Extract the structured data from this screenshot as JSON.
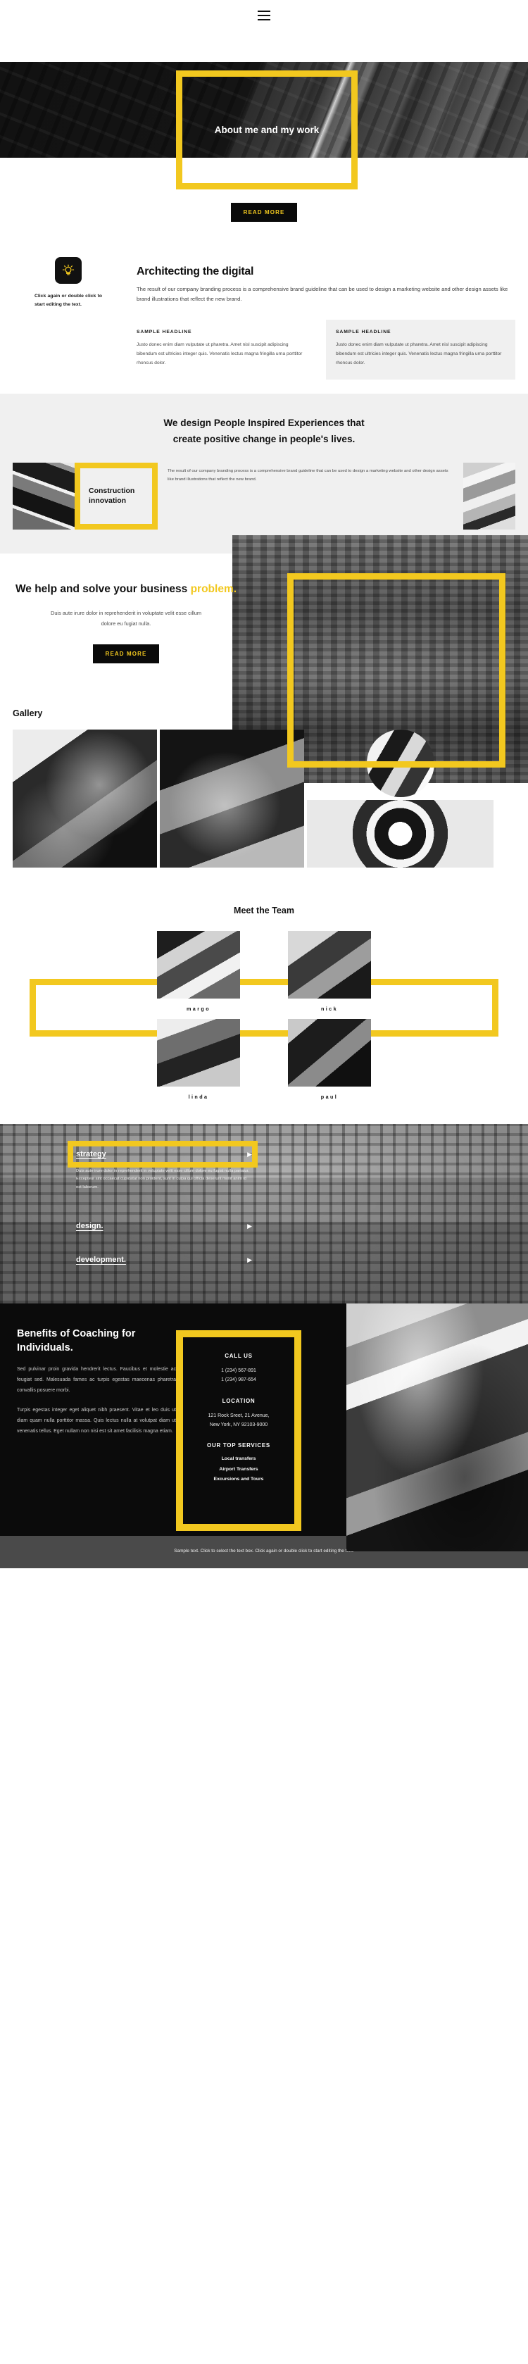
{
  "header": {
    "menu_icon": "hamburger-menu-icon"
  },
  "hero": {
    "title": "About me and my work",
    "read_more": "READ MORE"
  },
  "architecting": {
    "icon": "lightbulb-icon",
    "caption": "Click again or double click to start editing the text.",
    "heading": "Architecting the digital",
    "body": "The result of our company branding process is a comprehensive brand guideline that can be used to design a marketing website and other design assets like brand illustrations that reflect the new brand.",
    "cards": [
      {
        "headline": "SAMPLE HEADLINE",
        "text": "Justo donec enim diam vulputate ut pharetra. Amet nisl suscipit adipiscing bibendum est ultricies integer quis. Venenatis lectus magna fringilla urna porttitor rhoncus dolor."
      },
      {
        "headline": "SAMPLE HEADLINE",
        "text": "Justo donec enim diam vulputate ut pharetra. Amet nisl suscipit adipiscing bibendum est ultricies integer quis. Venenatis lectus magna fringilla urna porttitor rhoncus dolor."
      }
    ]
  },
  "people": {
    "heading_line1": "We design People Inspired Experiences that",
    "heading_line2": "create positive change in people's lives.",
    "card_title": "Construction innovation",
    "card_text": "The result of our company branding process is a comprehensive brand guideline that can be used to design a marketing website and other design assets like brand illustrations that reflect the new brand."
  },
  "help": {
    "heading_main": "We help and solve your business ",
    "heading_accent": "problem.",
    "body": "Duis aute irure dolor in reprehenderit in voluptate velit esse cillum dolore eu fugiat nulla.",
    "read_more": "READ MORE"
  },
  "gallery": {
    "title": "Gallery"
  },
  "team": {
    "title": "Meet the Team",
    "members": [
      {
        "name": "margo"
      },
      {
        "name": "nick"
      },
      {
        "name": "linda"
      },
      {
        "name": "paul"
      }
    ]
  },
  "services": [
    {
      "name": "strategy",
      "arrow": "play-arrow-icon",
      "desc": "Duis aute irure dolor in reprehenderit in voluptate velit esse cillum dolore eu fugiat nulla pariatur. Excepteur sint occaecat cupidatat non proident, sunt in culpa qui officia deserunt mollit anim id est laborum."
    },
    {
      "name": "design.",
      "arrow": "play-arrow-icon",
      "desc": ""
    },
    {
      "name": "development.",
      "arrow": "play-arrow-icon",
      "desc": ""
    }
  ],
  "benefits": {
    "heading": "Benefits of Coaching for Individuals.",
    "paragraph1": "Sed pulvinar proin gravida hendrerit lectus. Faucibus et molestie ac feugiat sed. Malesuada fames ac turpis egestas maecenas pharetra convallis posuere morbi.",
    "paragraph2": "Turpis egestas integer eget aliquet nibh praesent. Vitae et leo duis ut diam quam nulla porttitor massa. Quis lectus nulla at volutpat diam ut venenatis tellus. Eget nullam non nisi est sit amet facilisis magna etiam."
  },
  "contact": {
    "call_us_title": "CALL US",
    "phone1": "1 (234) 567-891",
    "phone2": "1 (234) 987-654",
    "location_title": "LOCATION",
    "address1": "121 Rock Sreet, 21 Avenue,",
    "address2": "New York, NY 92103-9000",
    "services_title": "OUR TOP SERVICES",
    "service1": "Local transfers",
    "service2": "Airport Transfers",
    "service3": "Excursions and Tours"
  },
  "footer": {
    "text": "Sample text. Click to select the text box. Click again or double click to start editing the text."
  },
  "colors": {
    "accent": "#f2c81f",
    "dark": "#0b0b0b",
    "grey_bg": "#f0f0f0"
  }
}
